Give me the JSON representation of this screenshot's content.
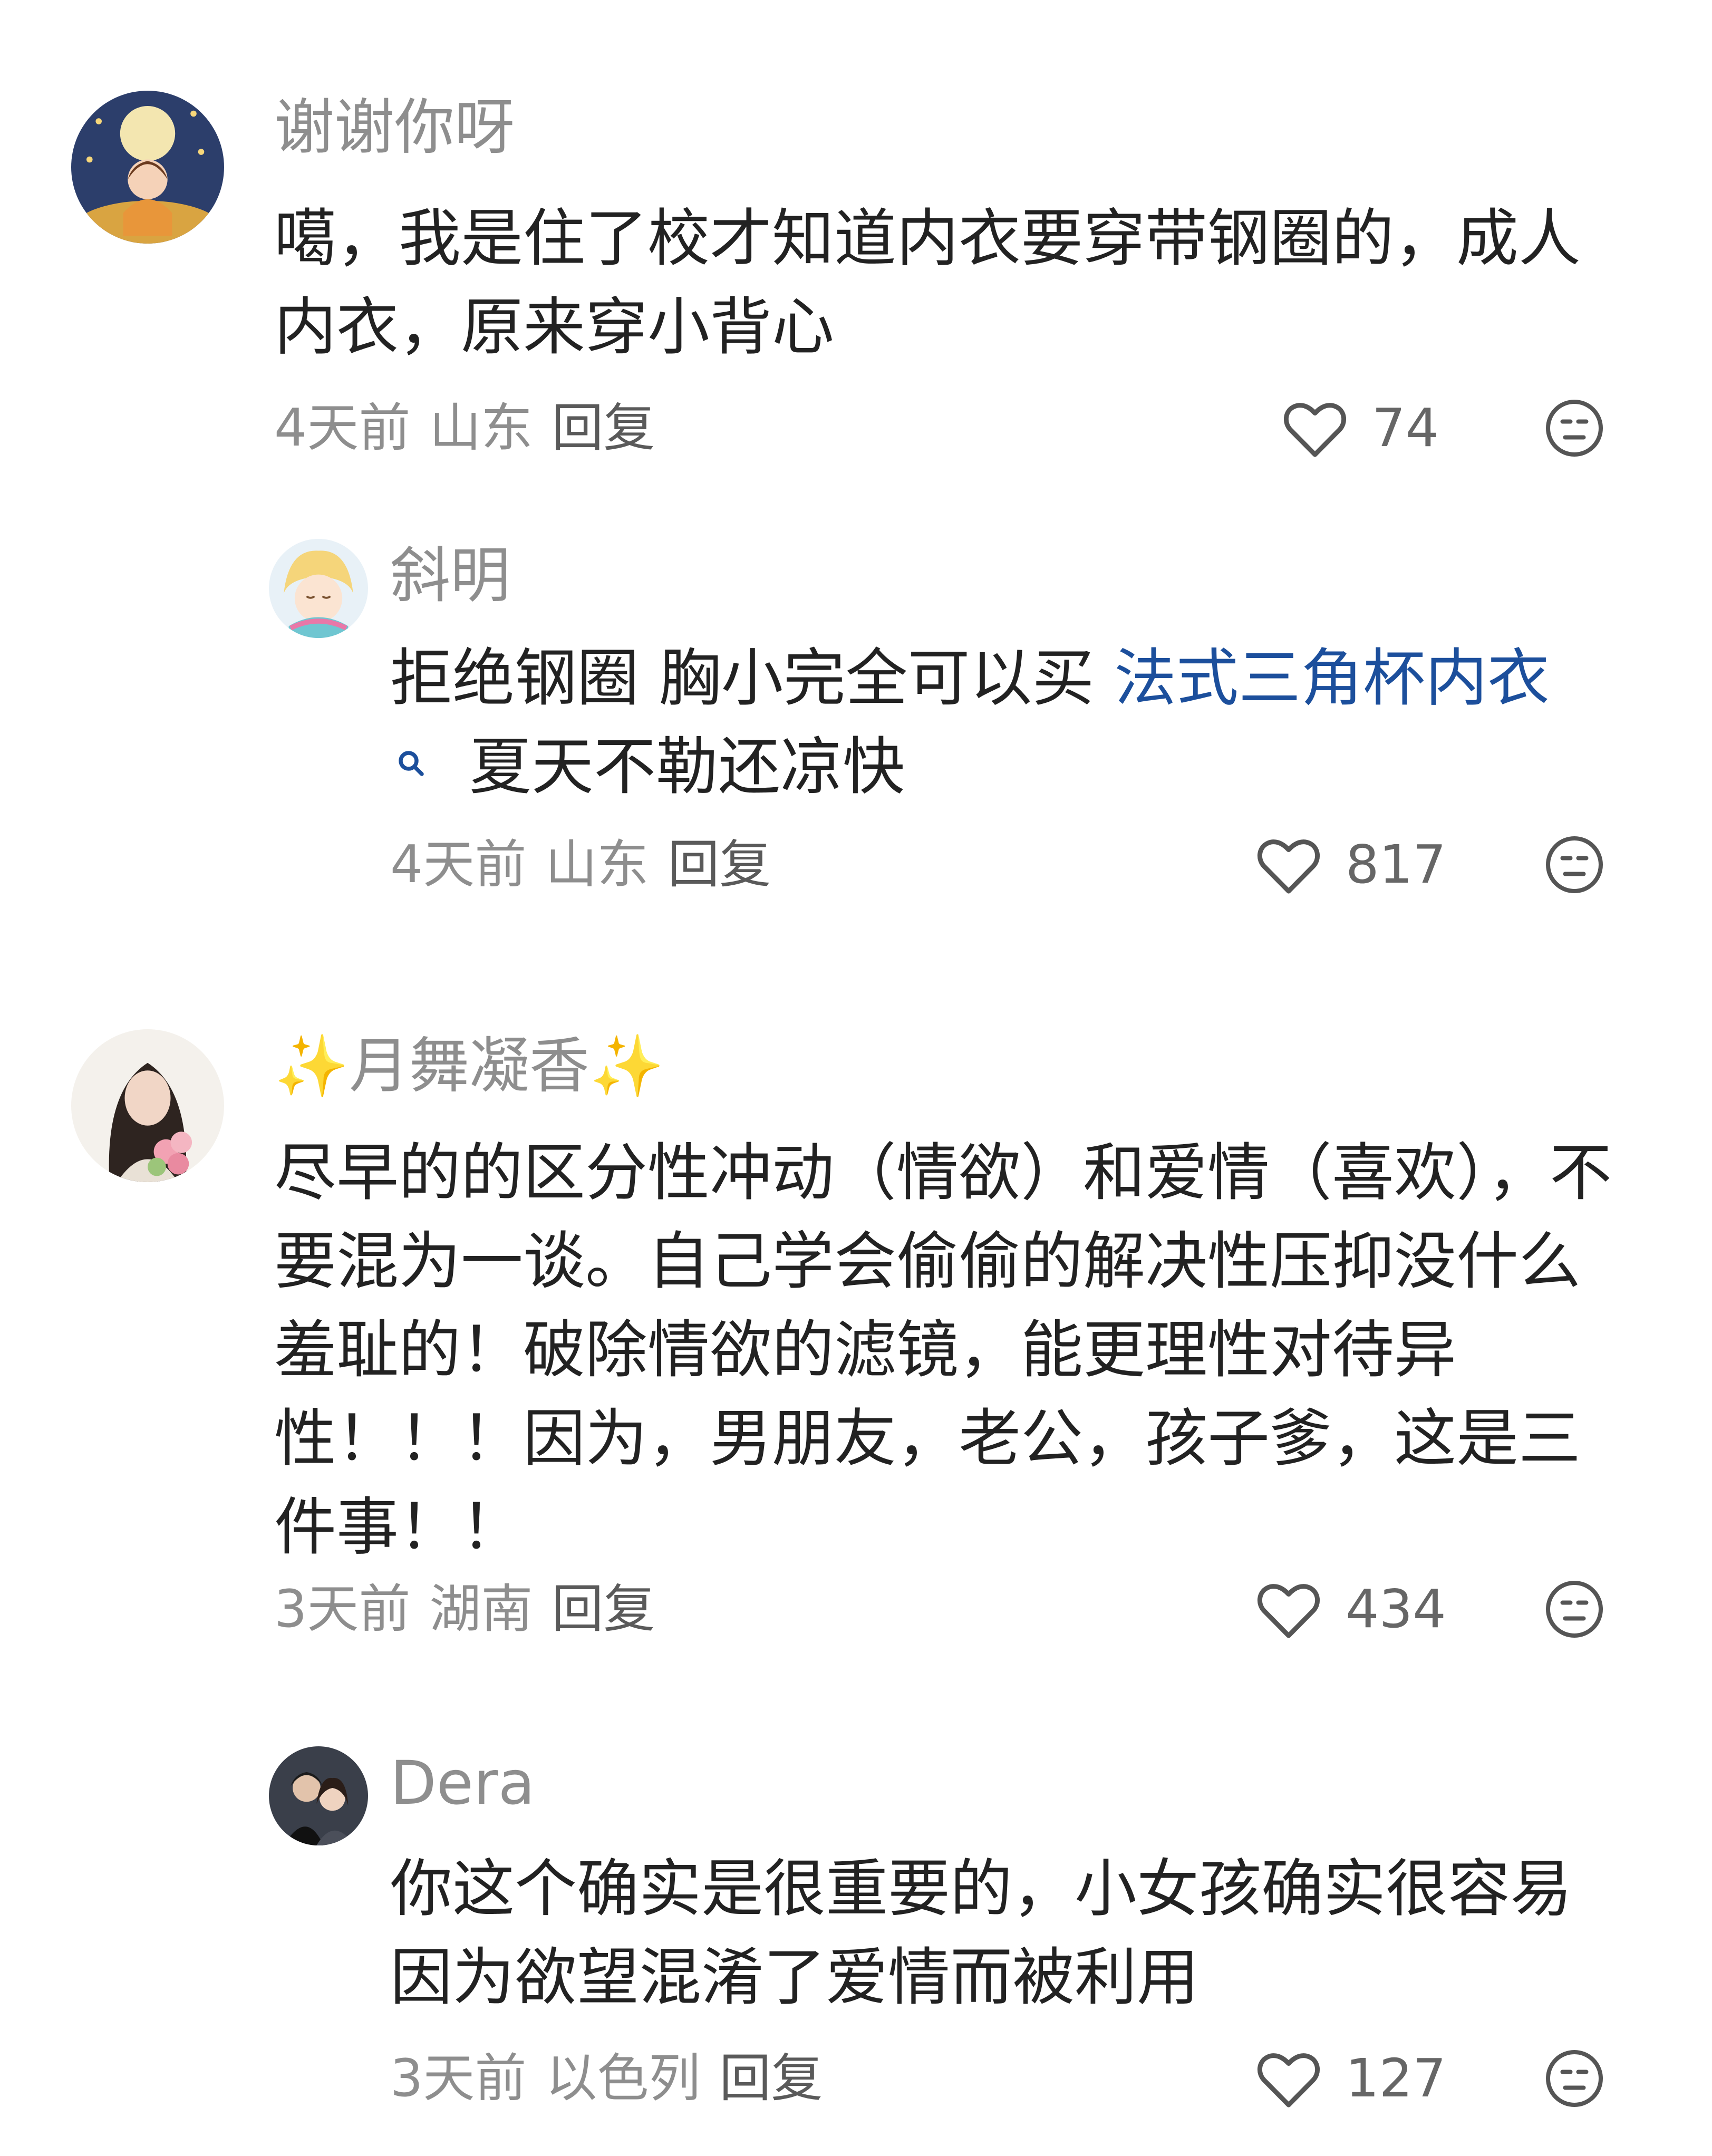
{
  "comments": [
    {
      "username": "谢谢你呀",
      "text": "噶，我是住了校才知道内衣要穿带钢圈的，成人内衣，原来穿小背心",
      "time": "4天前",
      "location": "山东",
      "reply_label": "回复",
      "likes": "74",
      "avatar_icon": "avatar-girl-moon"
    },
    {
      "username": "斜明",
      "text_before_link": "拒绝钢圈  胸小完全可以买 ",
      "link_text": "法式三角杯内衣",
      "search_icon": "search-icon",
      "text_after_link": "夏天不勒还凉快",
      "time": "4天前",
      "location": "山东",
      "reply_label": "回复",
      "likes": "817",
      "avatar_icon": "avatar-anime-girl"
    },
    {
      "username": "✨月舞凝香✨",
      "text": "尽早的的区分性冲动（情欲）和爱情（喜欢），不要混为一谈。自己学会偷偷的解决性压抑没什么羞耻的！破除情欲的滤镜，能更理性对待异性！！！因为，男朋友，老公，孩子爹，这是三件事！！",
      "time": "3天前",
      "location": "湖南",
      "reply_label": "回复",
      "likes": "434",
      "avatar_icon": "avatar-woman-flowers"
    },
    {
      "username": "Dera",
      "text": "你这个确实是很重要的，小女孩确实很容易因为欲望混淆了爱情而被利用",
      "time": "3天前",
      "location": "以色列",
      "reply_label": "回复",
      "likes": "127",
      "avatar_icon": "avatar-couple"
    }
  ],
  "icons": {
    "like": "heart-outline-icon",
    "dislike": "meh-face-icon"
  },
  "colors": {
    "username": "#8e8e8e",
    "text": "#222222",
    "link": "#1c4f9c",
    "meta": "#8e8e8e"
  }
}
